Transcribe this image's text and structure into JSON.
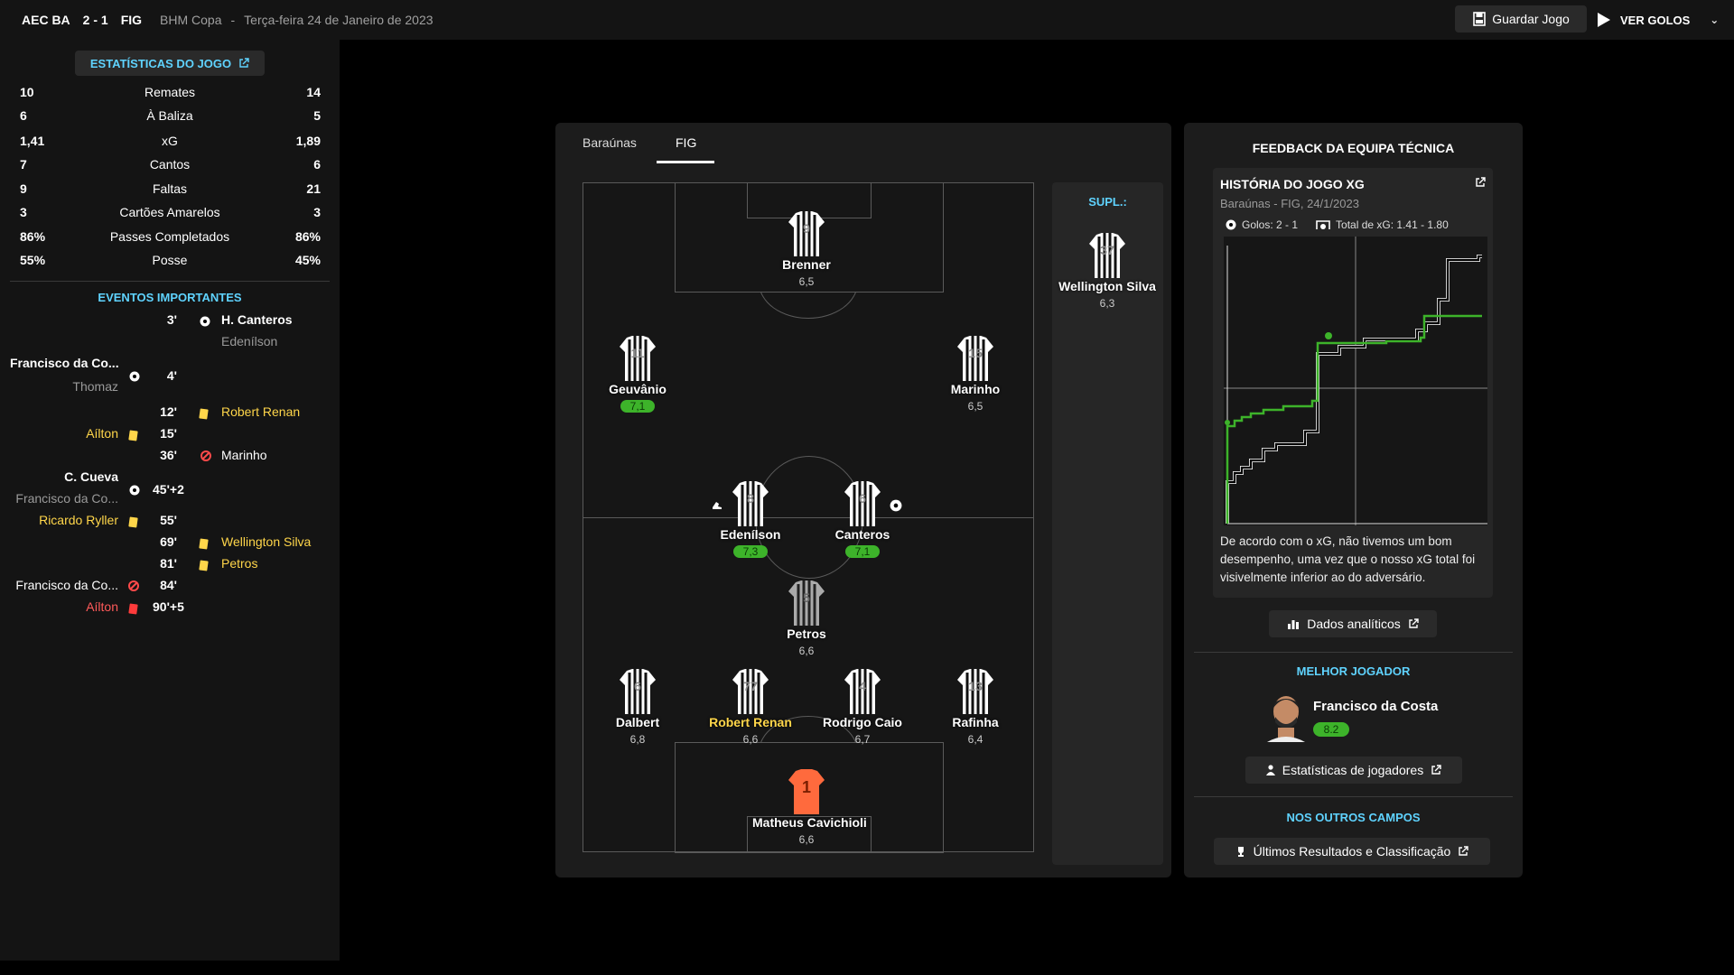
{
  "header": {
    "home": "AEC BA",
    "score": "2 - 1",
    "away": "FIG",
    "competition": "BHM Copa",
    "separator": "-",
    "date": "Terça-feira 24 de Janeiro de 2023",
    "save_label": "Guardar Jogo",
    "goals_label": "VER GOLOS"
  },
  "stats": {
    "button_label": "ESTATÍSTICAS DO JOGO",
    "rows": [
      {
        "home": "10",
        "label": "Remates",
        "away": "14"
      },
      {
        "home": "6",
        "label": "À Baliza",
        "away": "5"
      },
      {
        "home": "1,41",
        "label": "xG",
        "away": "1,89"
      },
      {
        "home": "7",
        "label": "Cantos",
        "away": "6"
      },
      {
        "home": "9",
        "label": "Faltas",
        "away": "21"
      },
      {
        "home": "3",
        "label": "Cartões Amarelos",
        "away": "3"
      },
      {
        "home": "86%",
        "label": "Passes Completados",
        "away": "86%"
      },
      {
        "home": "55%",
        "label": "Posse",
        "away": "45%"
      }
    ]
  },
  "events": {
    "title": "EVENTOS IMPORTANTES",
    "items": [
      {
        "time": "3'",
        "right": "H. Canteros",
        "right_sub": "Edenílson"
      },
      {
        "time": "4'",
        "left": "Francisco da Co...",
        "left_sub": "Thomaz"
      },
      {
        "time": "12'",
        "right": "Robert Renan"
      },
      {
        "time": "15'",
        "left": "Aílton"
      },
      {
        "time": "36'",
        "right": "Marinho"
      },
      {
        "time": "45'+2",
        "left": "C. Cueva",
        "left_sub": "Francisco da Co..."
      },
      {
        "time": "55'",
        "left": "Ricardo Ryller"
      },
      {
        "time": "69'",
        "right": "Wellington Silva"
      },
      {
        "time": "81'",
        "right": "Petros"
      },
      {
        "time": "84'",
        "left": "Francisco da Co..."
      },
      {
        "time": "90'+5",
        "left": "Aílton"
      }
    ]
  },
  "lineup": {
    "tabs": [
      "Baraúnas",
      "FIG"
    ],
    "active_tab": "FIG",
    "subs_title": "SUPL.:",
    "players": {
      "brenner": {
        "number": "9",
        "name": "Brenner",
        "rating": "6,5"
      },
      "geuvanio": {
        "number": "11",
        "name": "Geuvânio",
        "rating": "7,1"
      },
      "marinho": {
        "number": "15",
        "name": "Marinho",
        "rating": "6,5"
      },
      "edenilson": {
        "number": "8",
        "name": "Edenílson",
        "rating": "7,3"
      },
      "canteros": {
        "number": "6",
        "name": "Canteros",
        "rating": "7,1"
      },
      "petros": {
        "number": "5",
        "name": "Petros",
        "rating": "6,6"
      },
      "dalbert": {
        "number": "6",
        "name": "Dalbert",
        "rating": "6,8"
      },
      "renan": {
        "number": "77",
        "name": "Robert Renan",
        "rating": "6,6"
      },
      "caio": {
        "number": "4",
        "name": "Rodrigo Caio",
        "rating": "6,7"
      },
      "rafinha": {
        "number": "13",
        "name": "Rafinha",
        "rating": "6,4"
      },
      "keeper": {
        "number": "1",
        "name": "Matheus Cavichioli",
        "rating": "6,6"
      },
      "sub1": {
        "number": "37",
        "name": "Wellington Silva",
        "rating": "6,3"
      }
    }
  },
  "feedback": {
    "title": "FEEDBACK DA EQUIPA TÉCNICA",
    "xg_title": "HISTÓRIA DO JOGO XG",
    "xg_sub": "Baraúnas - FIG, 24/1/2023",
    "goals_legend": "Golos: 2 - 1",
    "xg_legend": "Total de xG: 1.41 - 1.80",
    "note": "De acordo com o xG, não tivemos um bom desempenho, uma vez que o nosso xG total foi visivelmente inferior ao do adversário.",
    "analytics_label": "Dados analíticos",
    "best_title": "MELHOR JOGADOR",
    "best_name": "Francisco da Costa",
    "best_rating": "8.2",
    "player_stats_label": "Estatísticas de jogadores",
    "other_title": "NOS OUTROS CAMPOS",
    "other_label": "Últimos Resultados e Classificação",
    "colors": {
      "home_line": "#000000",
      "away_line": "#3db32a",
      "accent": "#5fd3ff"
    }
  }
}
